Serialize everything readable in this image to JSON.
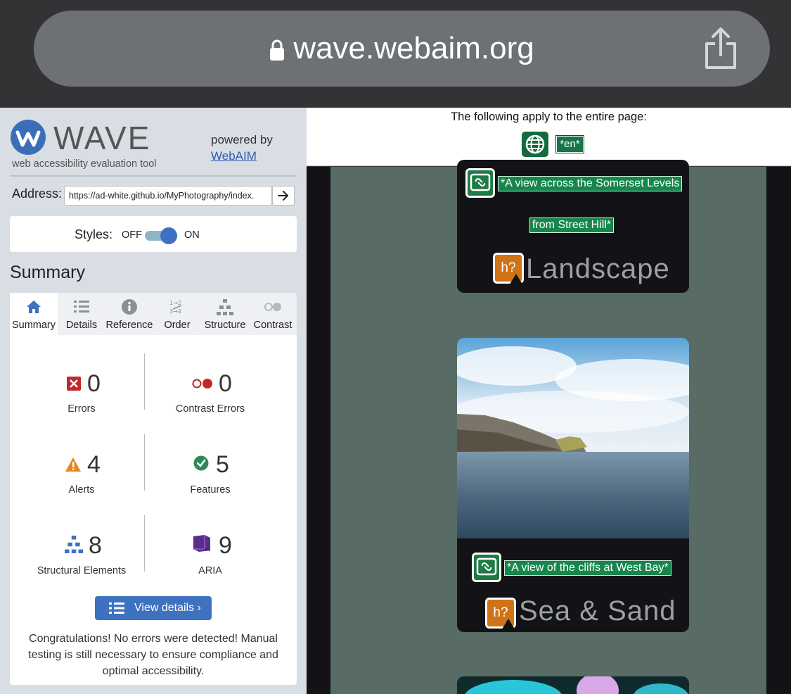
{
  "browser": {
    "url": "wave.webaim.org"
  },
  "wave": {
    "title": "WAVE",
    "subtitle": "web accessibility evaluation tool",
    "powered_by": "powered by",
    "webaim_link": "WebAIM",
    "address_label": "Address:",
    "address_value": "https://ad-white.github.io/MyPhotography/index.",
    "styles_label": "Styles:",
    "styles_off": "OFF",
    "styles_on": "ON",
    "styles_state": "on",
    "summary_heading": "Summary",
    "tabs": [
      {
        "label": "Summary",
        "icon": "home-icon",
        "active": true
      },
      {
        "label": "Details",
        "icon": "list-icon",
        "active": false
      },
      {
        "label": "Reference",
        "icon": "info-icon",
        "active": false
      },
      {
        "label": "Order",
        "icon": "order-icon",
        "active": false
      },
      {
        "label": "Structure",
        "icon": "structure-icon",
        "active": false
      },
      {
        "label": "Contrast",
        "icon": "contrast-icon",
        "active": false
      }
    ],
    "stats": {
      "errors": {
        "count": "0",
        "label": "Errors"
      },
      "contrast_errors": {
        "count": "0",
        "label": "Contrast Errors"
      },
      "alerts": {
        "count": "4",
        "label": "Alerts"
      },
      "features": {
        "count": "5",
        "label": "Features"
      },
      "structural": {
        "count": "8",
        "label": "Structural Elements"
      },
      "aria": {
        "count": "9",
        "label": "ARIA"
      }
    },
    "view_details": "View details ›",
    "congrats": "Congratulations! No errors were detected! Manual testing is still necessary to ensure compliance and optimal accessibility."
  },
  "page": {
    "apply_text": "The following apply to the entire page:",
    "lang_tag": "*en*",
    "cards": [
      {
        "caption_line1": "*A view across the Somerset Levels",
        "caption_line2": "from Street Hill*",
        "heading": "Landscape"
      },
      {
        "caption": "*A view of the cliffs at West Bay*",
        "heading": "Sea & Sand"
      }
    ]
  },
  "colors": {
    "accent": "#3e72c0",
    "error": "#c0282d",
    "alert": "#e8851c",
    "feature": "#2e8b57",
    "aria": "#5b2d8c",
    "wave_tag": "#17864d"
  }
}
